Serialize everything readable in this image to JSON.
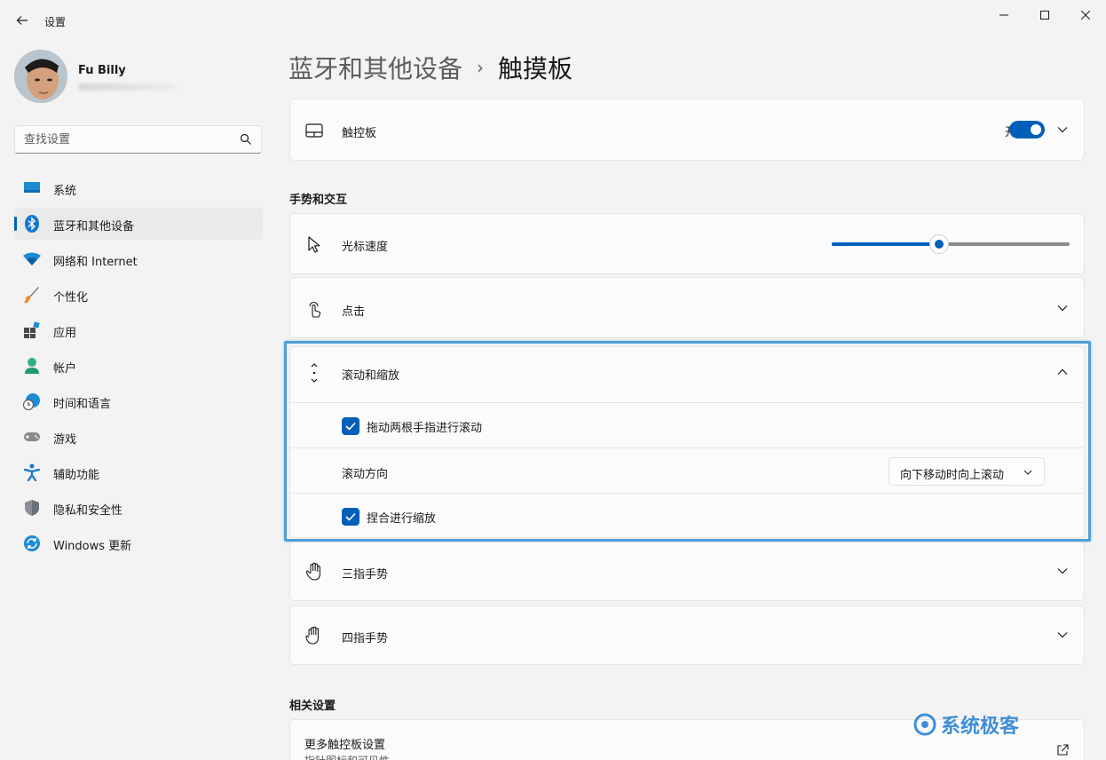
{
  "window": {
    "title": "设置"
  },
  "profile": {
    "name": "Fu Billy"
  },
  "search": {
    "placeholder": "查找设置"
  },
  "sidebar": {
    "items": [
      {
        "label": "系统",
        "icon": "monitor-icon"
      },
      {
        "label": "蓝牙和其他设备",
        "icon": "bluetooth-icon",
        "active": true
      },
      {
        "label": "网络和 Internet",
        "icon": "wifi-icon"
      },
      {
        "label": "个性化",
        "icon": "brush-icon"
      },
      {
        "label": "应用",
        "icon": "apps-icon"
      },
      {
        "label": "帐户",
        "icon": "person-icon"
      },
      {
        "label": "时间和语言",
        "icon": "globe-clock-icon"
      },
      {
        "label": "游戏",
        "icon": "gamepad-icon"
      },
      {
        "label": "辅助功能",
        "icon": "accessibility-icon"
      },
      {
        "label": "隐私和安全性",
        "icon": "shield-icon"
      },
      {
        "label": "Windows 更新",
        "icon": "update-icon"
      }
    ]
  },
  "breadcrumb": {
    "parent": "蓝牙和其他设备",
    "separator": "›",
    "current": "触摸板"
  },
  "touchpad": {
    "label": "触控板",
    "toggle_text": "开",
    "toggle_on": true
  },
  "sections": {
    "gestures": "手势和交互",
    "related": "相关设置"
  },
  "cursor_speed": {
    "label": "光标速度",
    "level": 0.45
  },
  "taps": {
    "label": "点击"
  },
  "scroll_zoom": {
    "label": "滚动和缩放",
    "drag_two_fingers": {
      "label": "拖动两根手指进行滚动",
      "checked": true
    },
    "scroll_direction": {
      "label": "滚动方向",
      "value": "向下移动时向上滚动"
    },
    "pinch_zoom": {
      "label": "捏合进行缩放",
      "checked": true
    }
  },
  "three_finger": {
    "label": "三指手势"
  },
  "four_finger": {
    "label": "四指手势"
  },
  "related": {
    "more_touchpad": "更多触控板设置",
    "more_touchpad_sub": "指针图标和可见性"
  },
  "watermark": {
    "text": "系统极客"
  },
  "colors": {
    "accent": "#005fb8",
    "highlight": "#4f9fd6"
  }
}
